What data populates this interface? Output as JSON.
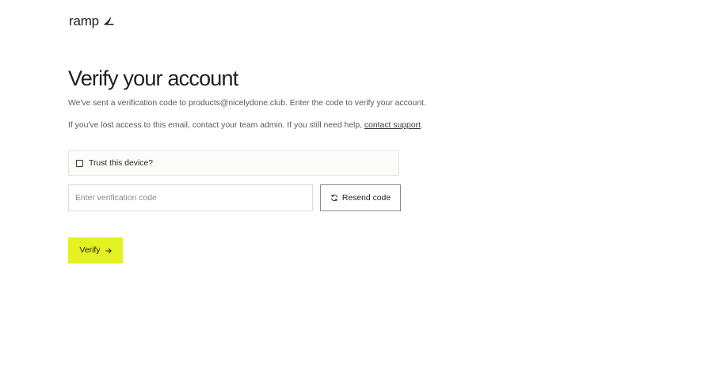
{
  "brand": {
    "name": "ramp",
    "accent_color": "#e4f221",
    "logo_icon": "ramp-wing-icon"
  },
  "main": {
    "title": "Verify your account",
    "description_sent": "We've sent a verification code to products@nicelydone.club. Enter the code to verify your account.",
    "description_lost_prefix": "If you've lost access to this email, contact your team admin. If you still need help, ",
    "contact_support_link": "contact support",
    "description_lost_suffix": "."
  },
  "trust_device": {
    "label": "Trust this device?",
    "checked": false
  },
  "verification_input": {
    "placeholder": "Enter verification code",
    "value": ""
  },
  "resend_button": {
    "label": "Resend code",
    "icon": "refresh-icon"
  },
  "verify_button": {
    "label": "Verify",
    "icon": "arrow-right-icon"
  }
}
